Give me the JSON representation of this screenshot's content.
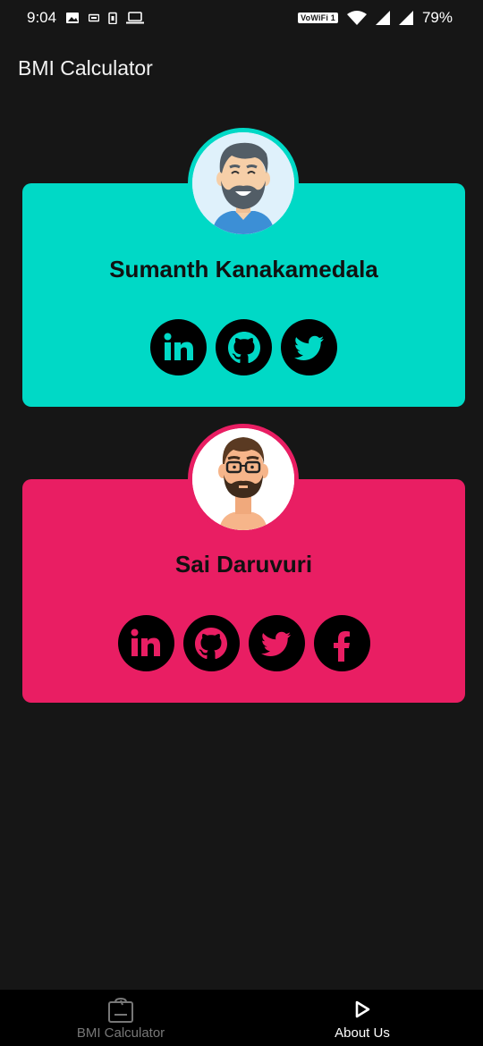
{
  "status_bar": {
    "time": "9:04",
    "network_badge": "VoWiFi 1",
    "battery": "79%"
  },
  "app_bar": {
    "title": "BMI Calculator"
  },
  "profiles": [
    {
      "name": "Sumanth Kanakamedala",
      "card_color": "#00d9c6",
      "avatar_icon": "smiling-bearded-man-avatar",
      "socials": [
        "linkedin-icon",
        "github-icon",
        "twitter-icon"
      ]
    },
    {
      "name": "Sai Daruvuri",
      "card_color": "#e91e63",
      "avatar_icon": "man-with-glasses-avatar",
      "socials": [
        "linkedin-icon",
        "github-icon",
        "twitter-icon",
        "facebook-icon"
      ]
    }
  ],
  "bottom_nav": {
    "items": [
      {
        "label": "BMI Calculator",
        "icon": "scale-icon",
        "active": false
      },
      {
        "label": "About Us",
        "icon": "play-icon",
        "active": true
      }
    ]
  }
}
